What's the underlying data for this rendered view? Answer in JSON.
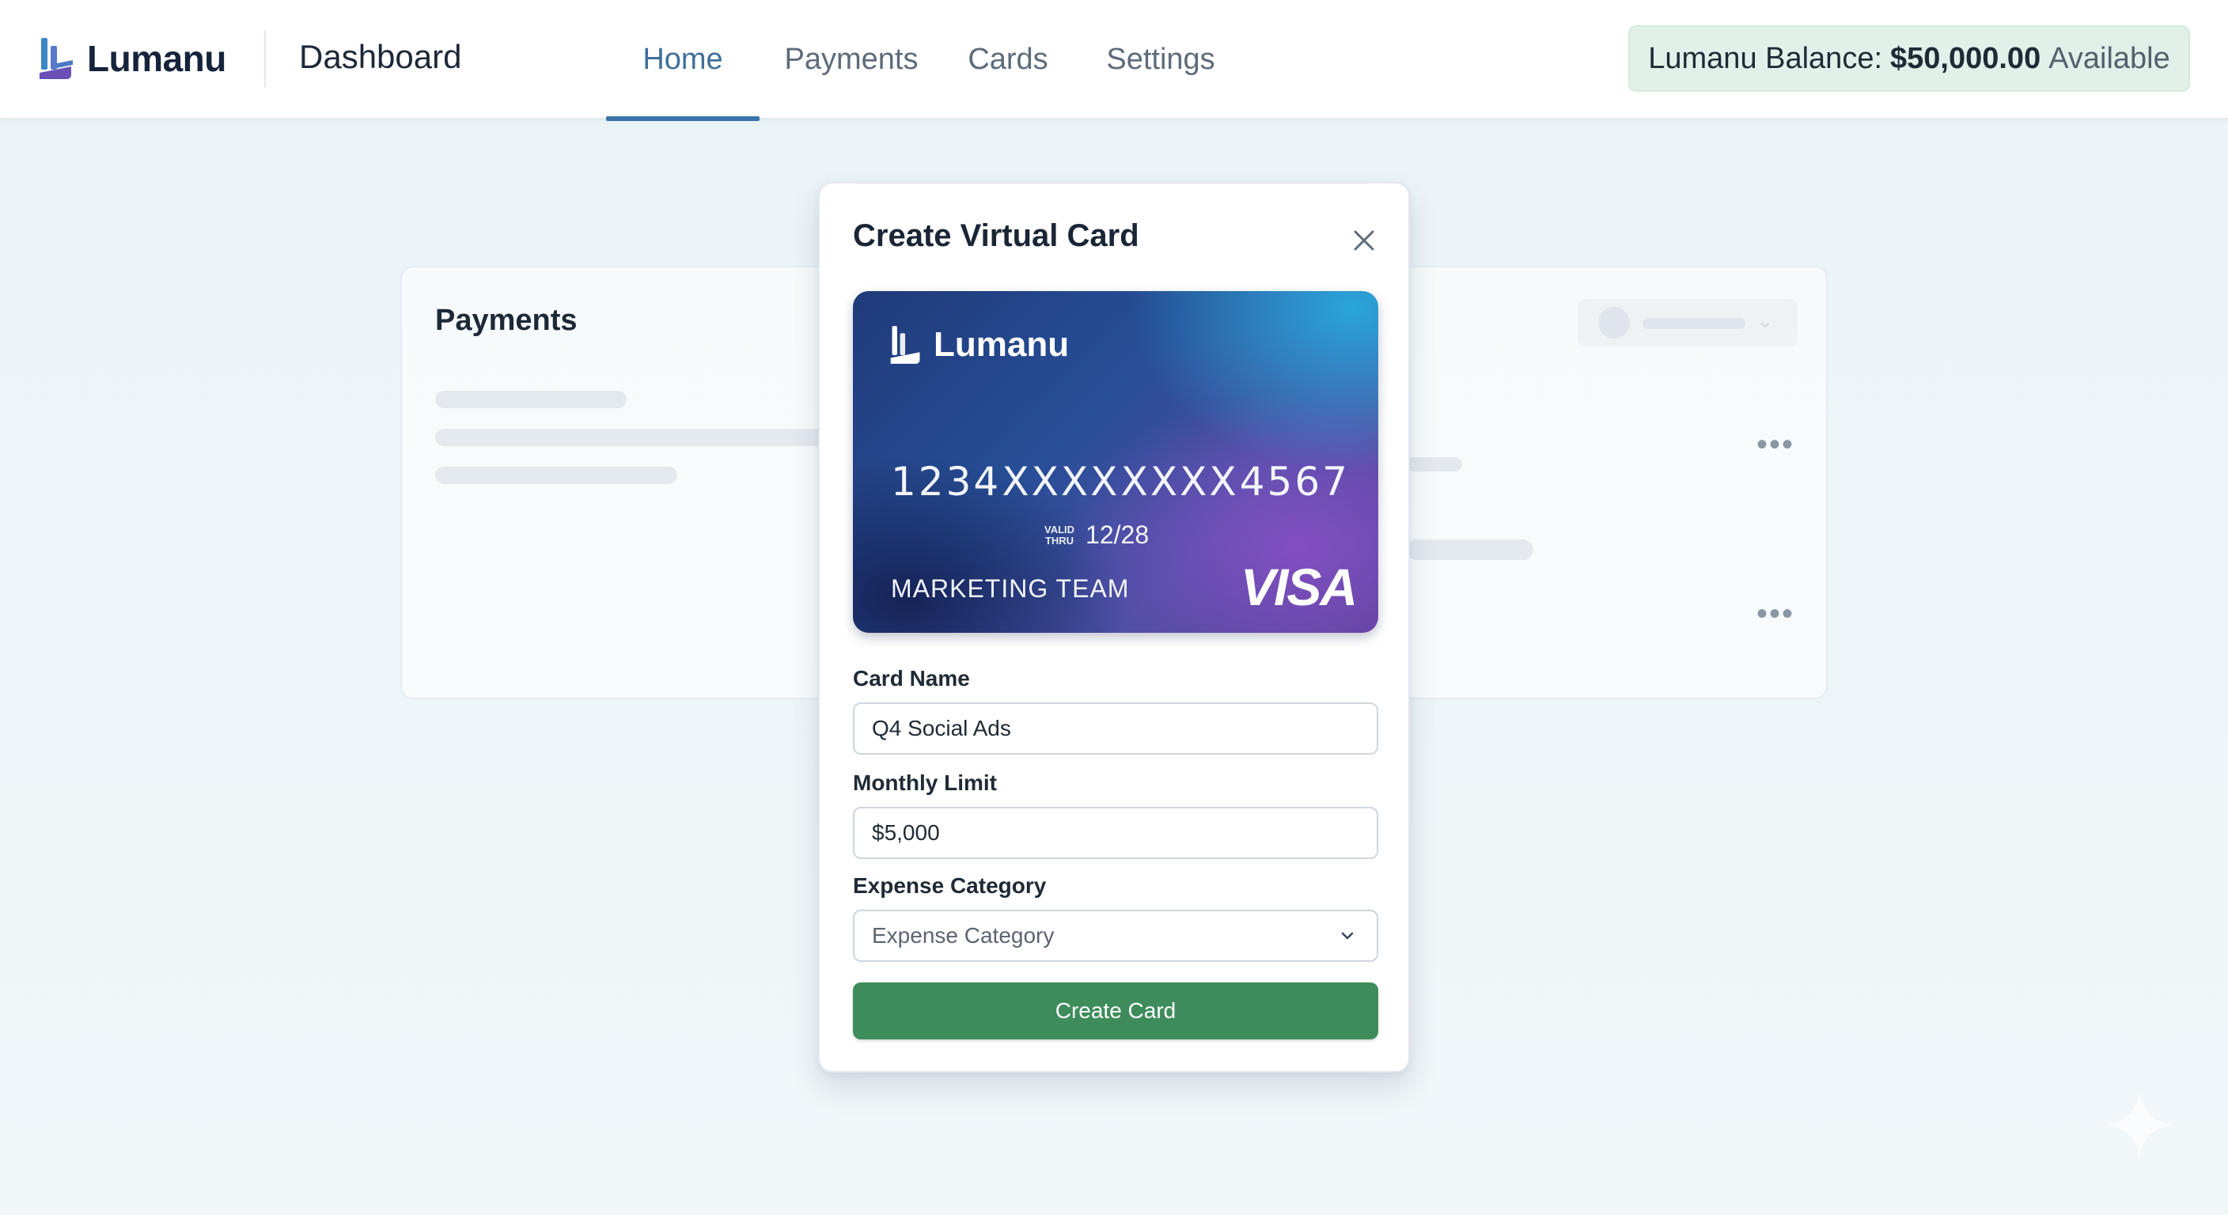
{
  "brand": {
    "name": "Lumanu"
  },
  "header": {
    "page_title": "Dashboard",
    "tabs": [
      {
        "label": "Home",
        "active": true
      },
      {
        "label": "Payments",
        "active": false
      },
      {
        "label": "Cards",
        "active": false
      },
      {
        "label": "Settings",
        "active": false
      }
    ],
    "balance": {
      "prefix": "Lumanu Balance:",
      "amount": "$50,000.00",
      "suffix": "Available"
    }
  },
  "background_panel": {
    "title": "Payments"
  },
  "modal": {
    "title": "Create Virtual Card",
    "card": {
      "brand": "Lumanu",
      "number_groups": [
        "1234",
        "XXXX",
        "XXXX",
        "4567"
      ],
      "valid_label_1": "VALID",
      "valid_label_2": "THRU",
      "expiry": "12/28",
      "holder": "MARKETING TEAM",
      "network": "VISA"
    },
    "form": {
      "card_name_label": "Card Name",
      "card_name_value": "Q4 Social Ads",
      "monthly_limit_label": "Monthly Limit",
      "monthly_limit_value": "$5,000",
      "category_label": "Expense Category",
      "category_placeholder": "Expense Category",
      "submit_label": "Create Card"
    }
  },
  "colors": {
    "accent": "#3a74a6",
    "primary_button": "#3e8c5c",
    "balance_bg": "#e2f0ea"
  }
}
